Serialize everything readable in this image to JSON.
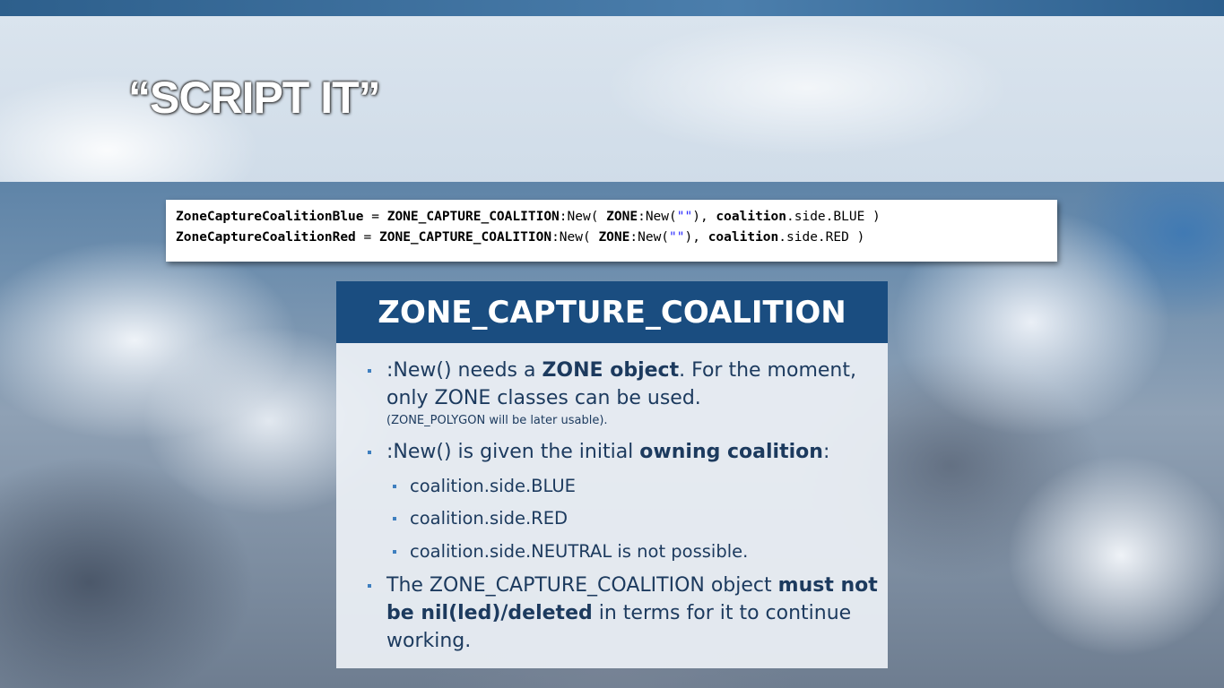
{
  "slide": {
    "title": "“SCRIPT IT”",
    "code": {
      "line1": {
        "var": "ZoneCaptureCoalitionBlue",
        "eq": " = ",
        "cls": "ZONE_CAPTURE_COALITION",
        "new1": ":New( ",
        "zone": "ZONE",
        "new2": ":New(",
        "str": "\"\"",
        "close": "), ",
        "coal": "coalition",
        "side": ".side.BLUE )"
      },
      "line2": {
        "var": "ZoneCaptureCoalitionRed",
        "eq": " = ",
        "cls": "ZONE_CAPTURE_COALITION",
        "new1": ":New( ",
        "zone": "ZONE",
        "new2": ":New(",
        "str": "\"\"",
        "close": "), ",
        "coal": "coalition",
        "side": ".side.RED )"
      }
    },
    "panel": {
      "header": "ZONE_CAPTURE_COALITION",
      "bullet1": {
        "pre": ":New() needs a ",
        "bold": "ZONE object",
        "post": ". For the moment, only ZONE classes can be used.",
        "note": "(ZONE_POLYGON  will be later usable)."
      },
      "bullet2": {
        "pre": ":New() is given the initial ",
        "bold": "owning coalition",
        "post": ":"
      },
      "sub_items": [
        "coalition.side.BLUE",
        "coalition.side.RED",
        "coalition.side.NEUTRAL is not possible."
      ],
      "bullet3": {
        "pre": "The ZONE_CAPTURE_COALITION object ",
        "bold": "must not be nil(led)/deleted",
        "post": " in terms for it to continue working."
      }
    }
  }
}
